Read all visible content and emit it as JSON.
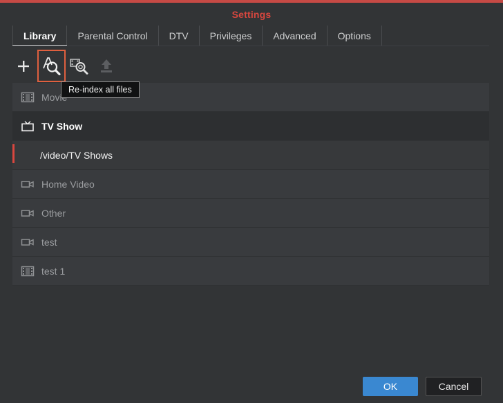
{
  "window": {
    "title": "Settings"
  },
  "tabs": [
    {
      "label": "Library",
      "active": true
    },
    {
      "label": "Parental Control"
    },
    {
      "label": "DTV"
    },
    {
      "label": "Privileges"
    },
    {
      "label": "Advanced"
    },
    {
      "label": "Options"
    }
  ],
  "toolbar": {
    "buttons": [
      {
        "name": "add-icon"
      },
      {
        "name": "reindex-all-files-icon"
      },
      {
        "name": "reindex-folder-icon"
      },
      {
        "name": "upload-icon",
        "disabled": true
      }
    ],
    "tooltip": "Re-index all files"
  },
  "library": {
    "items": [
      {
        "label": "Movie",
        "icon": "film-icon"
      },
      {
        "label": "TV Show",
        "icon": "tv-icon"
      },
      {
        "label": "/video/TV Shows"
      },
      {
        "label": "Home Video",
        "icon": "camera-icon"
      },
      {
        "label": "Other",
        "icon": "camera-icon"
      },
      {
        "label": "test",
        "icon": "camera-icon"
      },
      {
        "label": "test 1",
        "icon": "film-icon"
      }
    ]
  },
  "footer": {
    "ok_label": "OK",
    "cancel_label": "Cancel"
  },
  "colors": {
    "accent": "#3a88d1",
    "title": "#d8473f",
    "highlight": "#e0603f"
  }
}
